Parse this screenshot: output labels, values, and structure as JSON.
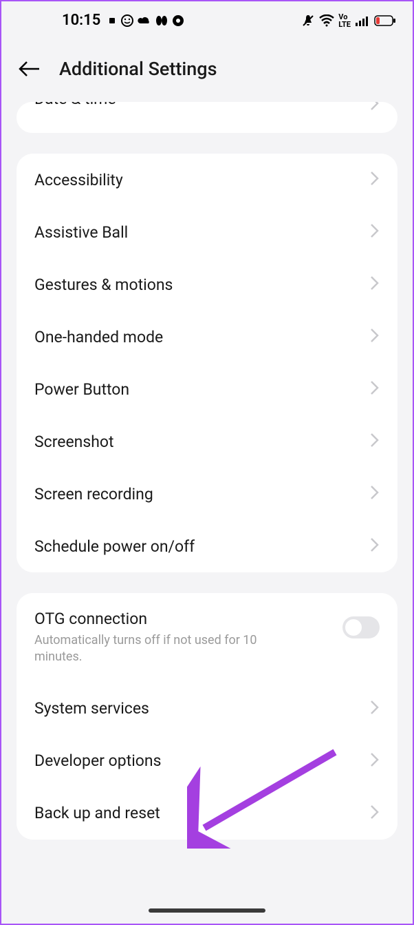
{
  "status": {
    "time": "10:15"
  },
  "header": {
    "title": "Additional Settings"
  },
  "partial": {
    "item_label": "Date & time"
  },
  "group1": {
    "items": [
      {
        "label": "Accessibility"
      },
      {
        "label": "Assistive Ball"
      },
      {
        "label": "Gestures & motions"
      },
      {
        "label": "One-handed mode"
      },
      {
        "label": "Power Button"
      },
      {
        "label": "Screenshot"
      },
      {
        "label": "Screen recording"
      },
      {
        "label": "Schedule power on/off"
      }
    ]
  },
  "group2": {
    "otg": {
      "label": "OTG connection",
      "sub": "Automatically turns off if not used for 10 minutes."
    },
    "items": [
      {
        "label": "System services"
      },
      {
        "label": "Developer options"
      },
      {
        "label": "Back up and reset"
      }
    ]
  }
}
